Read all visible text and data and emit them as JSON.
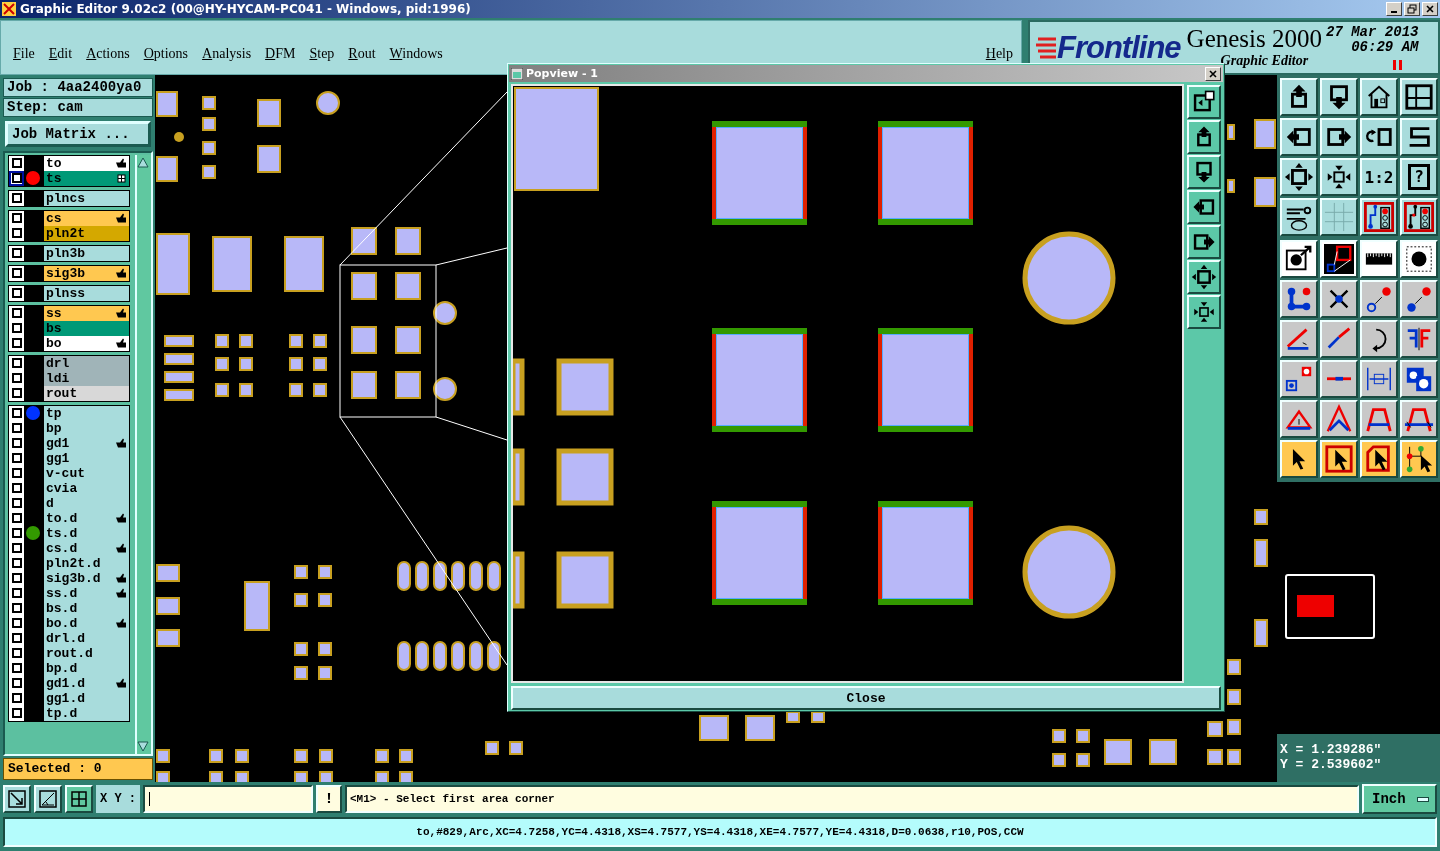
{
  "window": {
    "title": "Graphic Editor 9.02c2 (00@HY-HYCAM-PC041 - Windows, pid:1996)"
  },
  "menu": [
    "File",
    "Edit",
    "Actions",
    "Options",
    "Analysis",
    "DFM",
    "Step",
    "Rout",
    "Windows"
  ],
  "help_menu": "Help",
  "branding": {
    "logo": "Frontline",
    "product": "Genesis 2000",
    "subtitle": "Graphic Editor",
    "date": "27 Mar 2013",
    "time": "06:29 AM"
  },
  "job": {
    "job": "Job : 4aa2400ya0",
    "step": "Step: cam",
    "matrix_button": "Job Matrix ..."
  },
  "layer_groups": [
    {
      "layers": [
        {
          "name": "to",
          "kind": "silk_screen",
          "checked": false,
          "focused": false,
          "affected": true,
          "work": false
        },
        {
          "name": "ts",
          "kind": "solder_mask",
          "checked": false,
          "focused": true,
          "affected": false,
          "work": true,
          "color": "#ff0000"
        }
      ]
    },
    {
      "layers": [
        {
          "name": "plncs",
          "kind": "document",
          "checked": false,
          "focused": false,
          "affected": false,
          "work": false
        }
      ]
    },
    {
      "layers": [
        {
          "name": "cs",
          "kind": "signal",
          "checked": false,
          "focused": false,
          "affected": true,
          "work": false
        },
        {
          "name": "pln2t",
          "kind": "power_ground",
          "checked": false,
          "focused": false,
          "affected": false,
          "work": false
        }
      ]
    },
    {
      "layers": [
        {
          "name": "pln3b",
          "kind": "document",
          "checked": false,
          "focused": false,
          "affected": false,
          "work": false
        }
      ]
    },
    {
      "layers": [
        {
          "name": "sig3b",
          "kind": "signal",
          "checked": false,
          "focused": false,
          "affected": true,
          "work": false
        }
      ]
    },
    {
      "layers": [
        {
          "name": "plnss",
          "kind": "document",
          "checked": false,
          "focused": false,
          "affected": false,
          "work": false
        }
      ]
    },
    {
      "layers": [
        {
          "name": "ss",
          "kind": "signal",
          "checked": false,
          "focused": false,
          "affected": true,
          "work": false
        },
        {
          "name": "bs",
          "kind": "solder_mask",
          "checked": false,
          "focused": false,
          "affected": false,
          "work": false
        },
        {
          "name": "bo",
          "kind": "silk_screen",
          "checked": false,
          "focused": false,
          "affected": true,
          "work": false
        }
      ]
    },
    {
      "layers": [
        {
          "name": "drl",
          "kind": "drill",
          "checked": false,
          "focused": false,
          "affected": false,
          "work": false
        },
        {
          "name": "ldi",
          "kind": "drill",
          "checked": false,
          "focused": false,
          "affected": false,
          "work": false
        },
        {
          "name": "rout",
          "kind": "rout",
          "checked": false,
          "focused": false,
          "affected": false,
          "work": false
        }
      ]
    },
    {
      "layers": [
        {
          "name": "tp",
          "kind": "document",
          "checked": false,
          "focused": false,
          "affected": false,
          "work": false,
          "color": "#0033ff"
        },
        {
          "name": "bp",
          "kind": "document",
          "checked": false,
          "focused": false,
          "affected": false,
          "work": false
        },
        {
          "name": "gd1",
          "kind": "document",
          "checked": false,
          "focused": false,
          "affected": true,
          "work": false
        },
        {
          "name": "gg1",
          "kind": "document",
          "checked": false,
          "focused": false,
          "affected": false,
          "work": false
        },
        {
          "name": "v-cut",
          "kind": "document",
          "checked": false,
          "focused": false,
          "affected": false,
          "work": false
        },
        {
          "name": "cvia",
          "kind": "document",
          "checked": false,
          "focused": false,
          "affected": false,
          "work": false
        },
        {
          "name": "d",
          "kind": "document",
          "checked": false,
          "focused": false,
          "affected": false,
          "work": false
        },
        {
          "name": "to.d",
          "kind": "document",
          "checked": false,
          "focused": false,
          "affected": true,
          "work": false
        },
        {
          "name": "ts.d",
          "kind": "document",
          "checked": false,
          "focused": false,
          "affected": false,
          "work": false,
          "color": "#339900"
        },
        {
          "name": "cs.d",
          "kind": "document",
          "checked": false,
          "focused": false,
          "affected": true,
          "work": false
        },
        {
          "name": "pln2t.d",
          "kind": "document",
          "checked": false,
          "focused": false,
          "affected": false,
          "work": false
        },
        {
          "name": "sig3b.d",
          "kind": "document",
          "checked": false,
          "focused": false,
          "affected": true,
          "work": false
        },
        {
          "name": "ss.d",
          "kind": "document",
          "checked": false,
          "focused": false,
          "affected": true,
          "work": false
        },
        {
          "name": "bs.d",
          "kind": "document",
          "checked": false,
          "focused": false,
          "affected": false,
          "work": false
        },
        {
          "name": "bo.d",
          "kind": "document",
          "checked": false,
          "focused": false,
          "affected": true,
          "work": false
        },
        {
          "name": "drl.d",
          "kind": "document",
          "checked": false,
          "focused": false,
          "affected": false,
          "work": false
        },
        {
          "name": "rout.d",
          "kind": "document",
          "checked": false,
          "focused": false,
          "affected": false,
          "work": false
        },
        {
          "name": "bp.d",
          "kind": "document",
          "checked": false,
          "focused": false,
          "affected": false,
          "work": false
        },
        {
          "name": "gd1.d",
          "kind": "document",
          "checked": false,
          "focused": false,
          "affected": true,
          "work": false
        },
        {
          "name": "gg1.d",
          "kind": "document",
          "checked": false,
          "focused": false,
          "affected": false,
          "work": false
        },
        {
          "name": "tp.d",
          "kind": "document",
          "checked": false,
          "focused": false,
          "affected": false,
          "work": false
        }
      ]
    }
  ],
  "selected_count": "Selected : 0",
  "toolbar": {
    "zoom_ratio": "1:2",
    "help_symbol": "?"
  },
  "coordinates": {
    "x": "X = 1.239286\"",
    "y": "Y = 2.539602\""
  },
  "popview": {
    "title": "Popview - 1",
    "close_button": "Close"
  },
  "command_bar": {
    "xy_label": "X Y :",
    "alert_button": "!",
    "prompt": "<M1> - Select first area corner",
    "units": "Inch"
  },
  "status_line": "to,#829,Arc,XC=4.7258,YC=4.4318,XS=4.7577,YS=4.4318,XE=4.7577,YE=4.4318,D=0.0638,r10,POS,CCW"
}
